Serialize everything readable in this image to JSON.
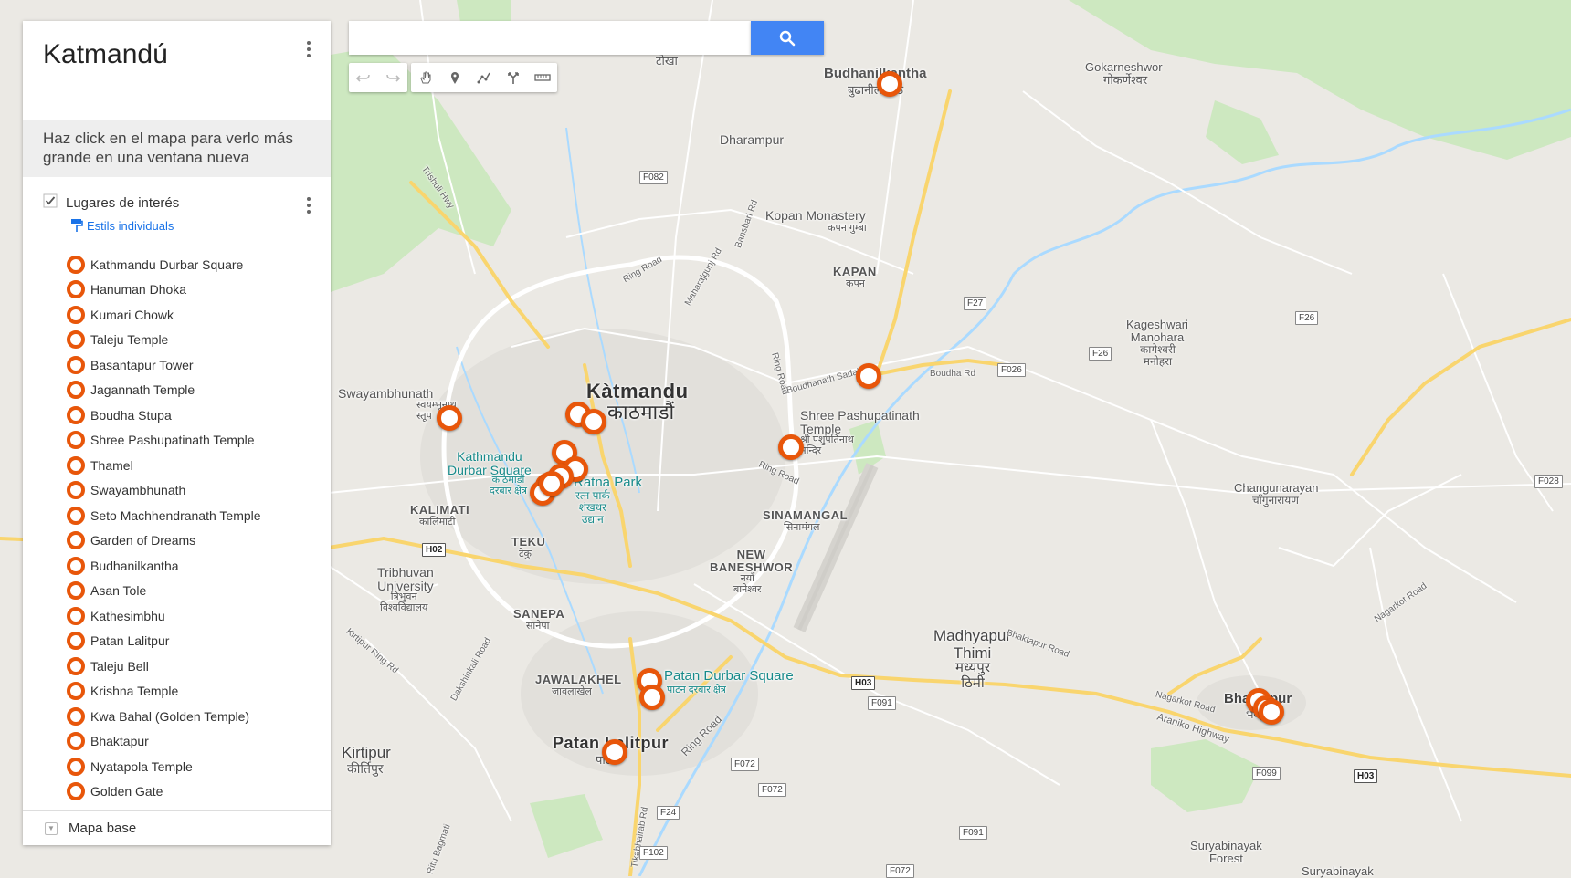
{
  "panel": {
    "title": "Katmandú",
    "notice": "Haz click en el mapa para verlo más grande en una ventana nueva",
    "layer": {
      "title": "Lugares de interés",
      "style_link": "Estils individuals",
      "places": [
        "Kathmandu Durbar Square",
        "Hanuman Dhoka",
        "Kumari Chowk",
        "Taleju Temple",
        "Basantapur Tower",
        "Jagannath Temple",
        "Boudha Stupa",
        "Shree Pashupatinath Temple",
        "Thamel",
        "Swayambhunath",
        "Seto Machhendranath Temple",
        "Garden of Dreams",
        "Budhanilkantha",
        "Asan Tole",
        "Kathesimbhu",
        "Patan Lalitpur",
        "Taleju Bell",
        "Krishna Temple",
        "Kwa Bahal (Golden Temple)",
        "Bhaktapur",
        "Nyatapola Temple",
        "Golden Gate"
      ]
    },
    "base_map": "Mapa base"
  },
  "search": {
    "value": "",
    "placeholder": ""
  },
  "colors": {
    "marker": "#e8560a",
    "search_button": "#4285f4",
    "link": "#1a73e8",
    "park": "#cde8c0"
  },
  "map_labels": {
    "katmandu": "Kàtmandu",
    "katmandu_np": "काठमाडौं",
    "budhanilkantha": "Budhanilkantha",
    "budhanilkantha_np": "बुढानीलकण्ठ",
    "gokarneshwor": "Gokarneshwor",
    "gokarneshwor_np": "गोकर्णेश्वर",
    "dharampur": "Dharampur",
    "tokha_np": "टोखा",
    "kopan": "Kopan Monastery",
    "kopan_np": "कपन गुम्बा",
    "kapan": "KAPAN",
    "kapan_np": "कपन",
    "kageshwari": "Kageshwari\nManohara",
    "kageshwari_np": "कागेश्वरी\nमनोहरा",
    "swayambhunath": "Swayambhunath",
    "swayambhunath_np": "स्वयम्भूनाथ\nस्तूप",
    "pashupatinath": "Shree Pashupatinath\nTemple",
    "pashupatinath_np": "श्री पशुपतिनाथ\nमन्दिर",
    "kdurbar": "Kathmandu\nDurbar Square",
    "kdurbar_np": "काठमाडौं\nदरबार क्षेत्र",
    "ratnapark": "Ratna Park",
    "ratnapark_np": "रत्न पार्क\nशंखधर\nउद्यान",
    "kalimati": "KALIMATI",
    "kalimati_np": "कालिमाटी",
    "teku": "TEKU",
    "teku_np": "टेकु",
    "sinamangal": "SINAMANGAL",
    "sinamangal_np": "सिनामंगल",
    "newbaneshwor": "NEW\nBANESHWOR",
    "newbaneshwor_np": "नयाँ\nबानेश्वर",
    "tribhuvan": "Tribhuvan\nUniversity",
    "tribhuvan_np": "त्रिभुवन\nविश्वविद्यालय",
    "sanepa": "SANEPA",
    "sanepa_np": "सानेपा",
    "jawalakhel": "JAWALAKHEL",
    "jawalakhel_np": "जावलाखेल",
    "pdurbar": "Patan Durbar Square",
    "pdurbar_np": "पाटन दरबार क्षेत्र",
    "patan": "Patan Lalitpur",
    "patan_np": "पाटन",
    "kirtipur": "Kirtipur",
    "kirtipur_np": "कीर्तिपुर",
    "madhyapur": "Madhyapur\nThimi",
    "madhyapur_np": "मध्यपुर\nठिमी",
    "changunarayan": "Changunarayan",
    "changunarayan_np": "चाँगुनारायण",
    "bhaktapur": "Bhaktapur",
    "bhaktapur_np": "भक्तपुर",
    "suryabinayak": "Suryabinayak\nForest",
    "suryabinayak2": "Suryabinayak",
    "trishuli": "Trishuli Hwy",
    "ringroad": "Ring Road",
    "boudharoad": "Boudhanath Sadak",
    "boudharoad2": "Boudha Rd",
    "araniko": "Araniko Highway",
    "nagarkot": "Nagarkot Road",
    "bhaktapurroad": "Bhaktapur Road",
    "kirtipurroad": "Kirtipur Ring Rd",
    "dakshinkali": "Dakshinkali Road",
    "maharajgunj": "Maharajgunj Rd",
    "bansbari": "Bansbari Rd",
    "tikabhairab": "Tikabhairab Rd",
    "ritubagmati": "Ritu Bagmati"
  },
  "road_shields": [
    "F082",
    "F27",
    "F026",
    "F26",
    "F26",
    "F028",
    "H02",
    "H03",
    "F091",
    "F072",
    "F072",
    "F24",
    "F102",
    "F091",
    "F099",
    "H03",
    "F072"
  ]
}
